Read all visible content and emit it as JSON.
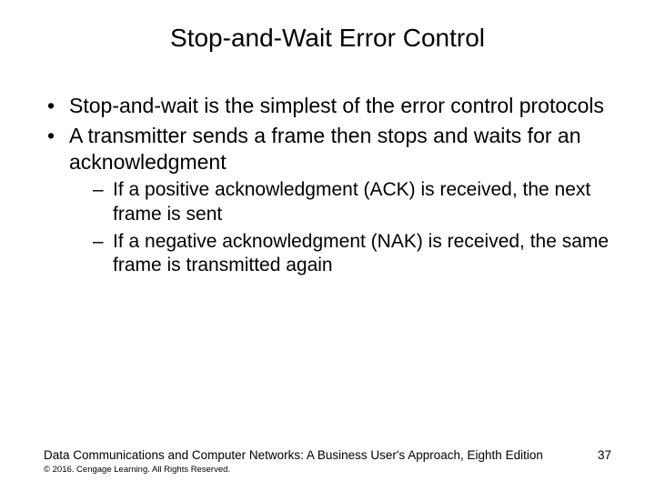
{
  "title": "Stop-and-Wait Error Control",
  "bullets": {
    "b1": "Stop-and-wait is the simplest of the error control protocols",
    "b2": "A transmitter sends a frame then stops and waits for an acknowledgment",
    "sub1": "If a positive acknowledgment (ACK) is received, the next frame is sent",
    "sub2": "If a negative acknowledgment (NAK) is received, the same frame is transmitted again"
  },
  "footer": {
    "book": "Data Communications and Computer Networks: A Business User's Approach, Eighth Edition",
    "copyright": "© 2016. Cengage Learning. All Rights Reserved.",
    "page": "37"
  }
}
